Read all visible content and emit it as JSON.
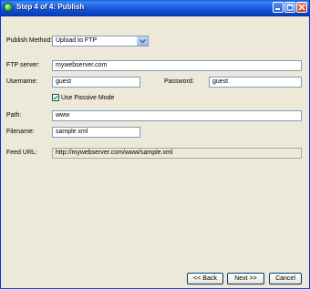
{
  "window": {
    "title": "Step 4 of 4: Publish",
    "icon": "green-orb-icon"
  },
  "form": {
    "publish_method_label": "Publish Method:",
    "publish_method_value": "Upload to FTP",
    "ftp_server_label": "FTP server:",
    "ftp_server_value": "mywebserver.com",
    "username_label": "Username:",
    "username_value": "guest",
    "password_label": "Password:",
    "password_value": "guest",
    "passive_mode_label": "Use Passive Mode",
    "passive_mode_checked": true,
    "path_label": "Path:",
    "path_value": "www",
    "filename_label": "Filename:",
    "filename_value": "sample.xml",
    "feed_url_label": "Feed URL:",
    "feed_url_value": "http://mywebserver.com/www/sample.xml"
  },
  "buttons": {
    "back": "<< Back",
    "next": "Next >>",
    "cancel": "Cancel"
  },
  "colors": {
    "titlebar": "#0a5bd8",
    "window_bg": "#ece9d8",
    "field_border": "#7f9db9"
  }
}
